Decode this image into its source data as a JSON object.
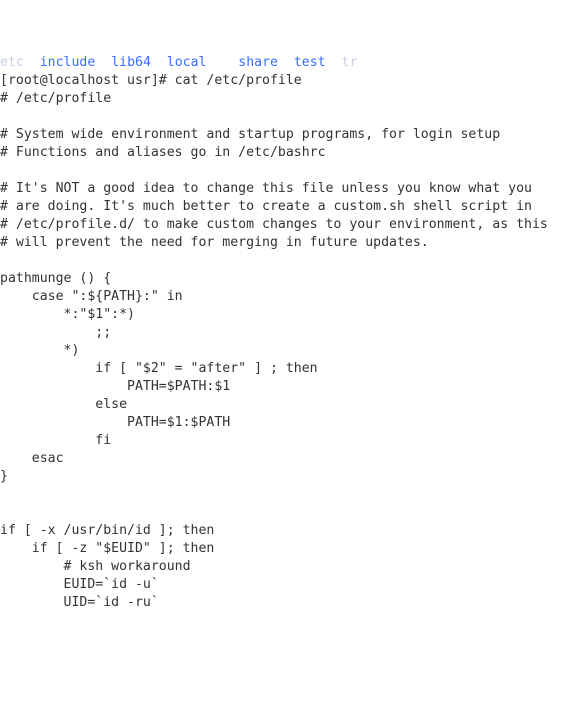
{
  "top_fragment": {
    "c1": "etc",
    "c2": "include",
    "c3": "lib64",
    "c4": "local",
    "c5": "share",
    "c6": "test",
    "c7": "tr"
  },
  "prompt": "[root@localhost usr]# cat /etc/profile",
  "lines": [
    "# /etc/profile",
    "",
    "# System wide environment and startup programs, for login setup",
    "# Functions and aliases go in /etc/bashrc",
    "",
    "# It's NOT a good idea to change this file unless you know what you",
    "# are doing. It's much better to create a custom.sh shell script in",
    "# /etc/profile.d/ to make custom changes to your environment, as this",
    "# will prevent the need for merging in future updates.",
    "",
    "pathmunge () {",
    "    case \":${PATH}:\" in",
    "        *:\"$1\":*)",
    "            ;;",
    "        *)",
    "            if [ \"$2\" = \"after\" ] ; then",
    "                PATH=$PATH:$1",
    "            else",
    "                PATH=$1:$PATH",
    "            fi",
    "    esac",
    "}",
    "",
    "",
    "if [ -x /usr/bin/id ]; then",
    "    if [ -z \"$EUID\" ]; then",
    "        # ksh workaround",
    "        EUID=`id -u`",
    "        UID=`id -ru`"
  ]
}
